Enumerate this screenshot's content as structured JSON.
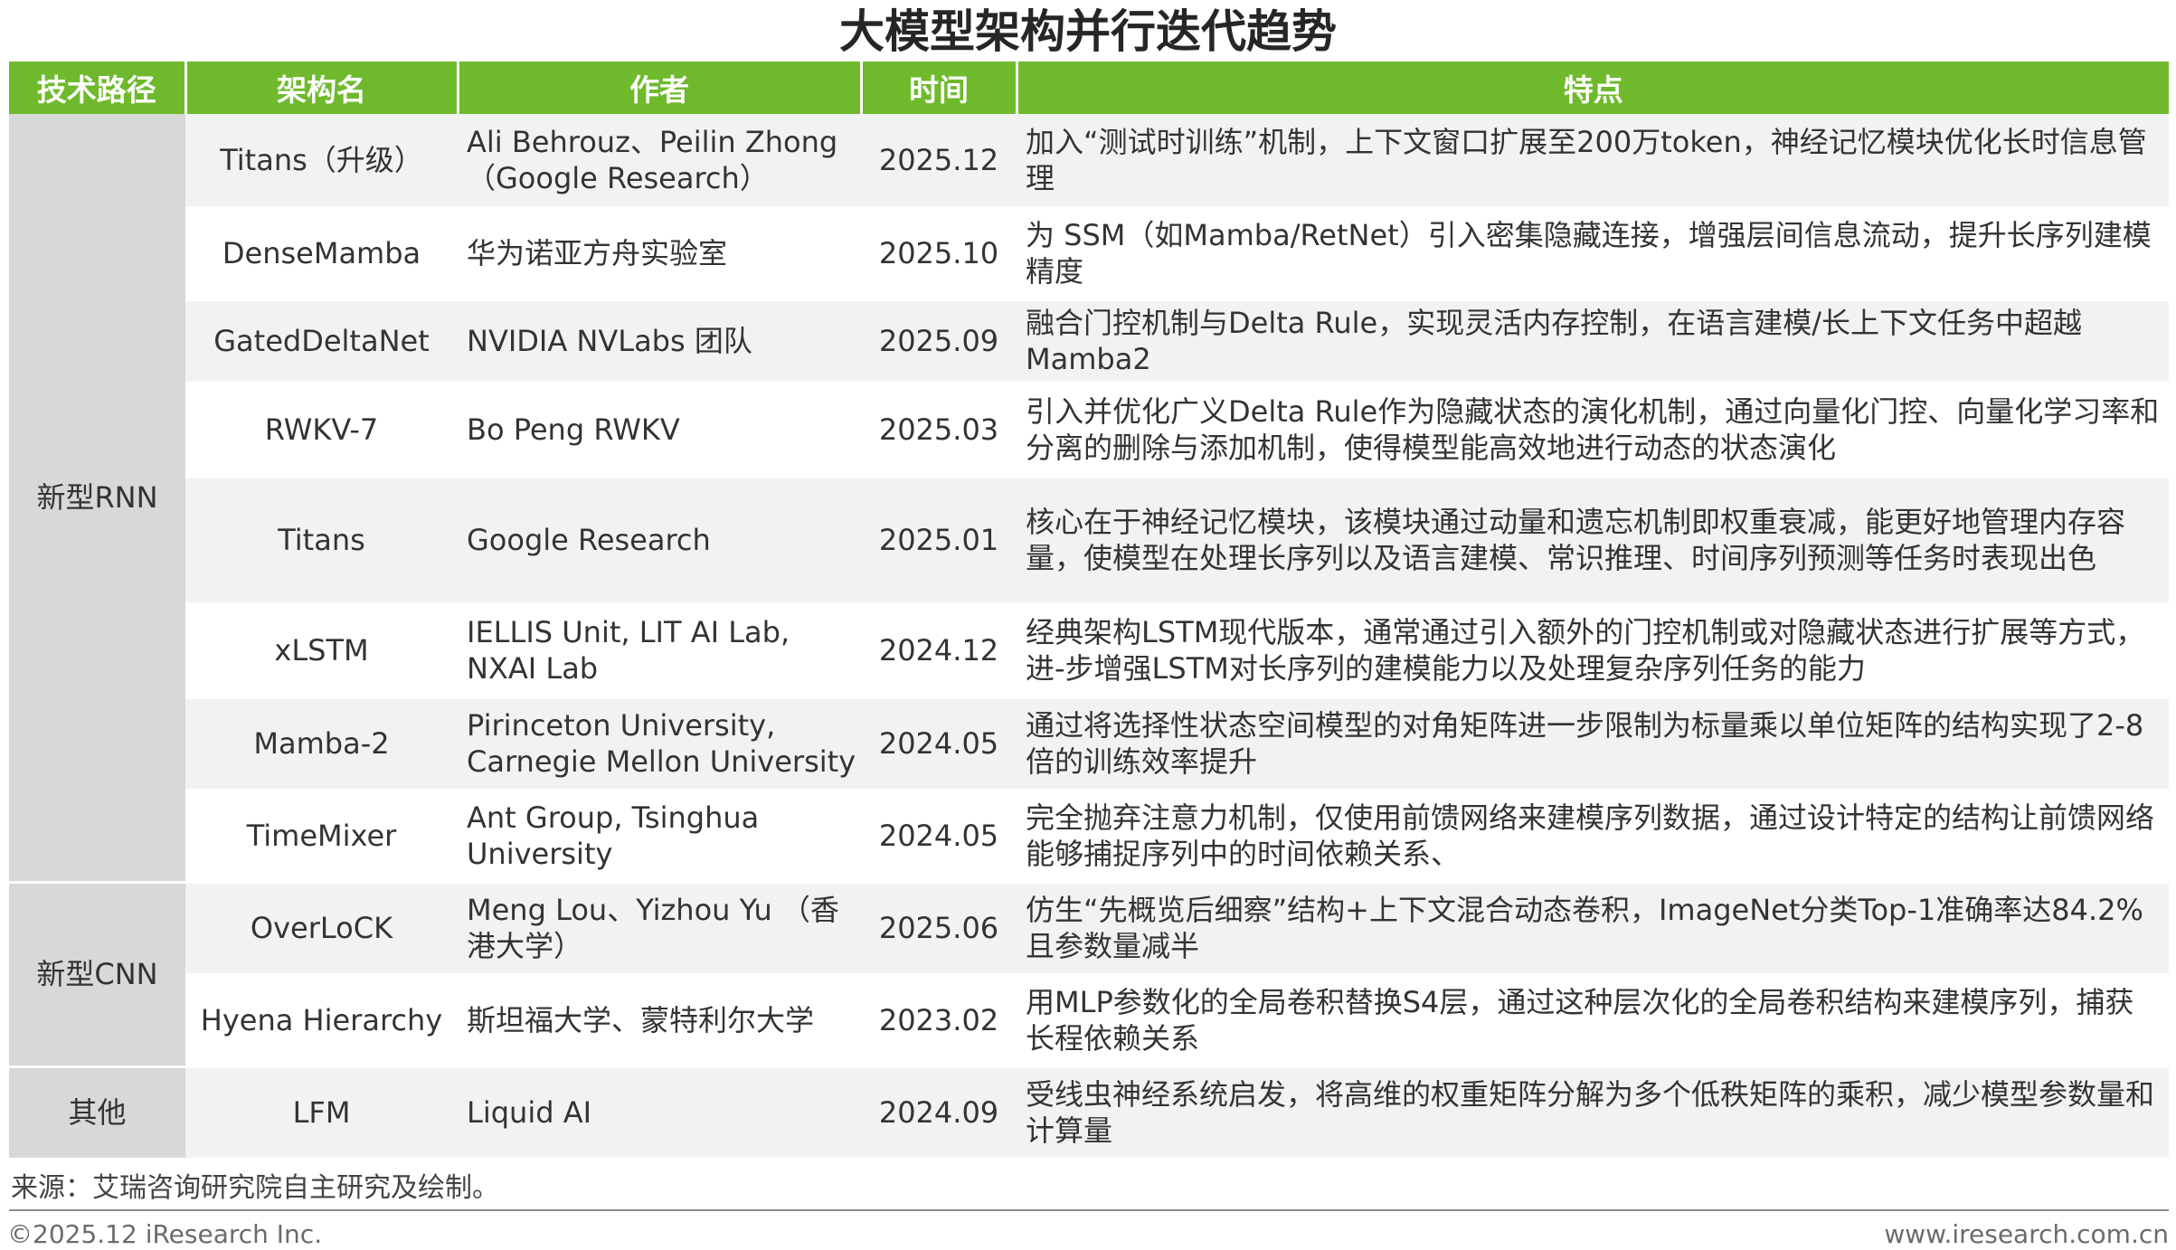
{
  "title": "大模型架构并行迭代趋势",
  "headers": {
    "route": "技术路径",
    "name": "架构名",
    "author": "作者",
    "time": "时间",
    "feature": "特点"
  },
  "groups": [
    {
      "label": "新型RNN"
    },
    {
      "label": "新型CNN"
    },
    {
      "label": "其他"
    }
  ],
  "rows": [
    {
      "name": "Titans（升级）",
      "author": "Ali Behrouz、Peilin Zhong （Google Research）",
      "time": "2025.12",
      "feature": "加入“测试时训练”机制，上下文窗口扩展至200万token，神经记忆模块优化长时信息管理"
    },
    {
      "name": "DenseMamba",
      "author": "华为诺亚方舟实验室",
      "time": "2025.10",
      "feature": "为 SSM（如Mamba/RetNet）引入密集隐藏连接，增强层间信息流动，提升长序列建模精度"
    },
    {
      "name": "GatedDeltaNet",
      "author": "NVIDIA NVLabs 团队",
      "time": "2025.09",
      "feature": "融合门控机制与Delta Rule，实现灵活内存控制，在语言建模/长上下文任务中超越Mamba2"
    },
    {
      "name": "RWKV-7",
      "author": "Bo Peng RWKV",
      "time": "2025.03",
      "feature": "引入并优化广义Delta Rule作为隐藏状态的演化机制，通过向量化门控、向量化学习率和分离的删除与添加机制，使得模型能高效地进行动态的状态演化"
    },
    {
      "name": "Titans",
      "author": "Google Research",
      "time": "2025.01",
      "feature": "核心在于神经记忆模块，该模块通过动量和遗忘机制即权重衰减，能更好地管理内存容量，使模型在处理长序列以及语言建模、常识推理、时间序列预测等任务时表现出色"
    },
    {
      "name": "xLSTM",
      "author": "IELLIS Unit, LIT AI Lab, NXAI Lab",
      "time": "2024.12",
      "feature": "经典架构LSTM现代版本，通常通过引入额外的门控机制或对隐藏状态进行扩展等方式，进-步增强LSTM对长序列的建模能力以及处理复杂序列任务的能力"
    },
    {
      "name": "Mamba-2",
      "author": "Pirinceton University, Carnegie Mellon University",
      "time": "2024.05",
      "feature": "通过将选择性状态空间模型的对角矩阵进一步限制为标量乘以单位矩阵的结构实现了2-8倍的训练效率提升"
    },
    {
      "name": "TimeMixer",
      "author": "Ant Group, Tsinghua University",
      "time": "2024.05",
      "feature": "完全抛弃注意力机制，仅使用前馈网络来建模序列数据，通过设计特定的结构让前馈网络能够捕捉序列中的时间依赖关系、"
    },
    {
      "name": "OverLoCK",
      "author": "Meng Lou、Yizhou Yu （香港大学）",
      "time": "2025.06",
      "feature": "仿生“先概览后细察”结构+上下文混合动态卷积，ImageNet分类Top-1准确率达84.2%且参数量减半"
    },
    {
      "name": "Hyena Hierarchy",
      "author": "斯坦福大学、蒙特利尔大学",
      "time": "2023.02",
      "feature": "用MLP参数化的全局卷积替换S4层，通过这种层次化的全局卷积结构来建模序列，捕获长程依赖关系"
    },
    {
      "name": "LFM",
      "author": "Liquid AI",
      "time": "2024.09",
      "feature": "受线虫神经系统启发，将高维的权重矩阵分解为多个低秩矩阵的乘积，减少模型参数量和计算量"
    }
  ],
  "source": "来源：艾瑞咨询研究院自主研究及绘制。",
  "copyright": "©2025.12 iResearch Inc.",
  "website": "www.iresearch.com.cn"
}
